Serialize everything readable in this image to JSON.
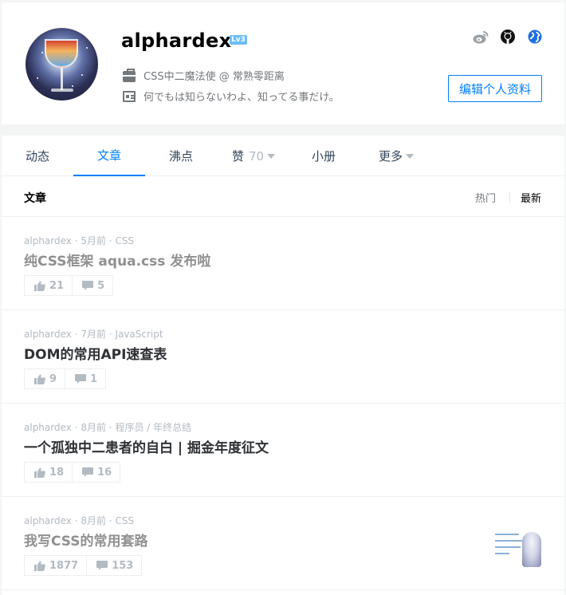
{
  "profile": {
    "username": "alphardex",
    "level": "Lv3",
    "job": "CSS中二魔法使 @ 常熟零距离",
    "intro": "何でもは知らないわよ、知ってる事だけ。",
    "edit_label": "编辑个人资料",
    "social_icons": [
      "weibo-icon",
      "github-icon",
      "website-icon"
    ]
  },
  "tabs": [
    {
      "label": "动态"
    },
    {
      "label": "文章",
      "active": true
    },
    {
      "label": "沸点"
    },
    {
      "label": "赞",
      "count": "70"
    },
    {
      "label": "小册"
    },
    {
      "label": "更多"
    }
  ],
  "section": {
    "title": "文章",
    "sort_hot": "热门",
    "sort_new": "最新"
  },
  "articles": [
    {
      "author": "alphardex",
      "time": "5月前",
      "tags": "CSS",
      "title": "纯CSS框架 aqua.css 发布啦",
      "likes": "21",
      "comments": "5"
    },
    {
      "author": "alphardex",
      "time": "7月前",
      "tags": "JavaScript",
      "title": "DOM的常用API速查表",
      "likes": "9",
      "comments": "1"
    },
    {
      "author": "alphardex",
      "time": "8月前",
      "tags": "程序员 / 年终总结",
      "title": "一个孤独中二患者的自白 | 掘金年度征文",
      "likes": "18",
      "comments": "16"
    },
    {
      "author": "alphardex",
      "time": "8月前",
      "tags": "CSS",
      "title": "我写CSS的常用套路",
      "likes": "1877",
      "comments": "153"
    }
  ],
  "colors": {
    "accent": "#007fff",
    "meta": "#b2bac2",
    "level_badge": "#6cbdf6"
  }
}
